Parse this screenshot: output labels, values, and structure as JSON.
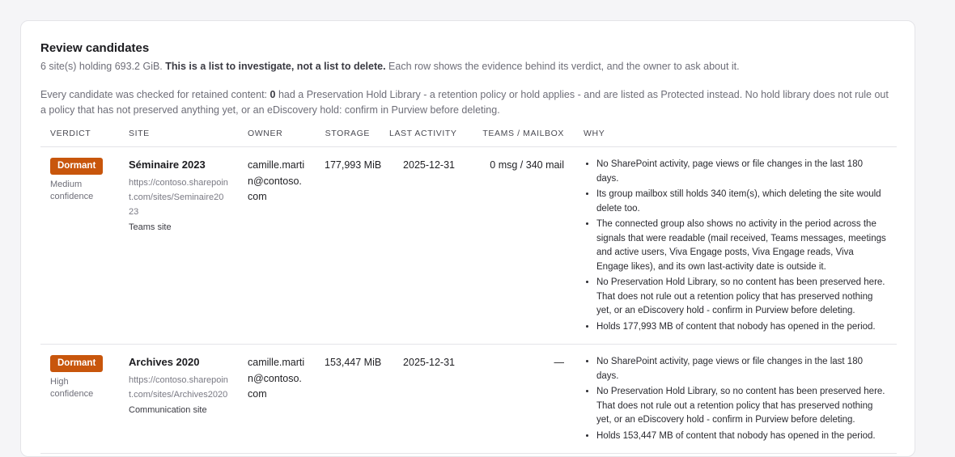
{
  "panel": {
    "title": "Review candidates",
    "summary_prefix": "6 site(s) holding 693.2 GiB.",
    "summary_bold": "This is a list to investigate, not a list to delete.",
    "summary_suffix": "Each row shows the evidence behind its verdict, and the owner to ask about it.",
    "note_prefix": "Every candidate was checked for retained content:",
    "note_count": "0",
    "note_suffix": "had a Preservation Hold Library - a retention policy or hold applies - and are listed as Protected instead. No hold library does not rule out a policy that has not preserved anything yet, or an eDiscovery hold: confirm in Purview before deleting."
  },
  "table": {
    "headers": {
      "verdict": "VERDICT",
      "site": "SITE",
      "owner": "OWNER",
      "storage": "STORAGE",
      "last_activity": "LAST ACTIVITY",
      "teams_mailbox": "TEAMS / MAILBOX",
      "why": "WHY"
    },
    "rows": [
      {
        "verdict": "Dormant",
        "confidence": "Medium confidence",
        "site_name": "Séminaire 2023",
        "site_url": "https://contoso.sharepoint.com/sites/Seminaire2023",
        "site_type": "Teams site",
        "owner": "camille.martin@contoso.com",
        "storage": "177,993 MiB",
        "last_activity": "2025-12-31",
        "teams_mailbox": "0 msg / 340 mail",
        "why": [
          "No SharePoint activity, page views or file changes in the last 180 days.",
          "Its group mailbox still holds 340 item(s), which deleting the site would delete too.",
          "The connected group also shows no activity in the period across the signals that were readable (mail received, Teams messages, meetings and active users, Viva Engage posts, Viva Engage reads, Viva Engage likes), and its own last-activity date is outside it.",
          "No Preservation Hold Library, so no content has been preserved here. That does not rule out a retention policy that has preserved nothing yet, or an eDiscovery hold - confirm in Purview before deleting.",
          "Holds 177,993 MB of content that nobody has opened in the period."
        ]
      },
      {
        "verdict": "Dormant",
        "confidence": "High confidence",
        "site_name": "Archives 2020",
        "site_url": "https://contoso.sharepoint.com/sites/Archives2020",
        "site_type": "Communication site",
        "owner": "camille.martin@contoso.com",
        "storage": "153,447 MiB",
        "last_activity": "2025-12-31",
        "teams_mailbox": "—",
        "why": [
          "No SharePoint activity, page views or file changes in the last 180 days.",
          "No Preservation Hold Library, so no content has been preserved here. That does not rule out a retention policy that has preserved nothing yet, or an eDiscovery hold - confirm in Purview before deleting.",
          "Holds 153,447 MB of content that nobody has opened in the period."
        ]
      }
    ]
  },
  "colors": {
    "badge": "#c8560c",
    "border": "#e4e4e8",
    "muted": "#6e6e78"
  }
}
